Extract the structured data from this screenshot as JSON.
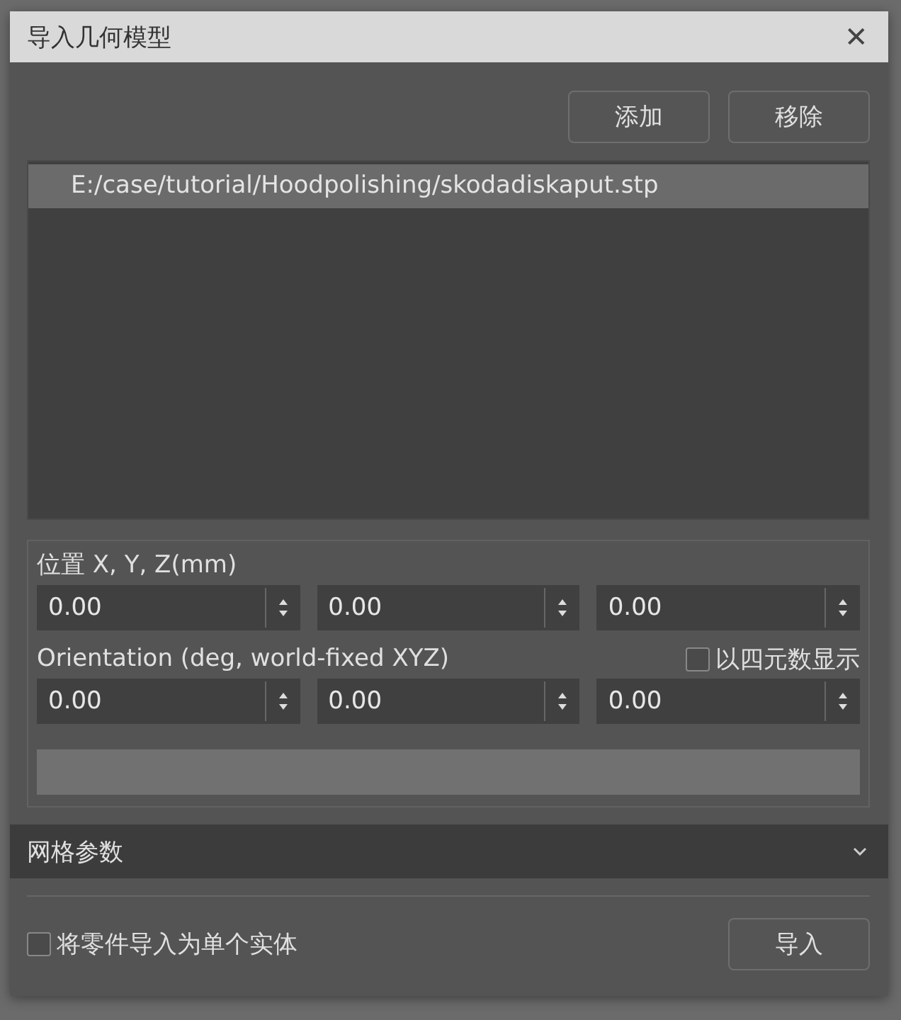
{
  "window": {
    "title": "导入几何模型",
    "close": "✕"
  },
  "toolbar": {
    "buttons": [
      "添加",
      "移除"
    ]
  },
  "file_list": [
    {
      "path": "E:/case/tutorial/Hoodpolishing/skodadiskaput.stp",
      "selected": true
    }
  ],
  "position": {
    "label": "位置 X, Y, Z(mm)",
    "values": [
      "0.00",
      "0.00",
      "0.00"
    ]
  },
  "orientation": {
    "label": "Orientation (deg, world-fixed XYZ)",
    "quaternion": {
      "label": "以四元数显示",
      "checked": false
    },
    "values": [
      "0.00",
      "0.00",
      "0.00"
    ]
  },
  "progress": {
    "level": 0
  },
  "mesh_section": {
    "title": "网格参数",
    "expanded": false
  },
  "footer": {
    "single_body": {
      "label": "将零件导入为单个实体",
      "checked": false
    },
    "import_button": "导入"
  }
}
